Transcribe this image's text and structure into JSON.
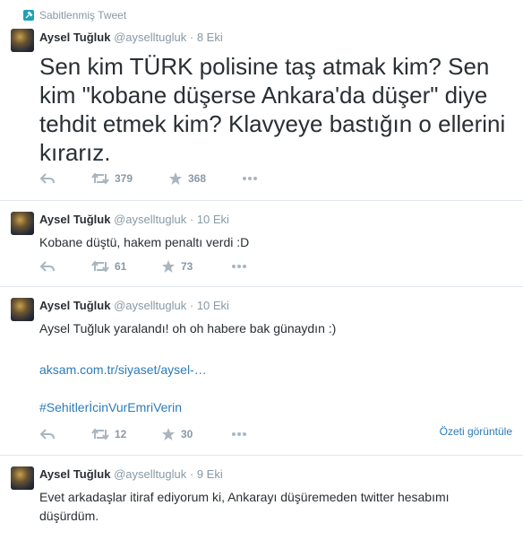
{
  "pinned_label": "Sabitlenmiş Tweet",
  "tweets": [
    {
      "name": "Aysel Tuğluk",
      "handle": "@ayselltugluk",
      "dot": "·",
      "time": "8 Eki",
      "text": "Sen kim TÜRK polisine taş atmak kim? Sen kim \"kobane düşerse Ankara'da düşer\" diye tehdit etmek kim? Klavyeye bastığın o ellerini kırarız.",
      "retweets": "379",
      "favorites": "368"
    },
    {
      "name": "Aysel Tuğluk",
      "handle": "@ayselltugluk",
      "dot": "·",
      "time": "10 Eki",
      "text": "Kobane düştü, hakem penaltı verdi :D",
      "retweets": "61",
      "favorites": "73"
    },
    {
      "name": "Aysel Tuğluk",
      "handle": "@ayselltugluk",
      "dot": "·",
      "time": "10 Eki",
      "text": "Aysel Tuğluk yaralandı! oh oh habere bak günaydın :)",
      "link": "aksam.com.tr/siyaset/aysel-…",
      "hashtag": "#SehitlerİcinVurEmriVerin",
      "summary": "Özeti görüntüle",
      "retweets": "12",
      "favorites": "30"
    },
    {
      "name": "Aysel Tuğluk",
      "handle": "@ayselltugluk",
      "dot": "·",
      "time": "9 Eki",
      "text": "Evet arkadaşlar itiraf ediyorum ki, Ankarayı düşüremeden twitter hesabımı düşürdüm."
    }
  ],
  "colors": {
    "link": "#2b7bb9",
    "muted": "#8899a6",
    "text": "#292f33",
    "pin": "#1da1b7"
  }
}
